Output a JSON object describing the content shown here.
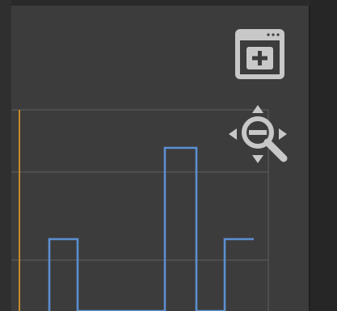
{
  "colors": {
    "panel_bg": "#3c3c3c",
    "grid_line": "#5a5a5a",
    "signal_line": "#5b8fd1",
    "cursor_line": "#c98a2a",
    "icon_color": "#c8c8c8"
  },
  "toolbar": {
    "add_window_icon": "window-add-icon",
    "zoom_icon": "zoom-pan-icon"
  }
}
